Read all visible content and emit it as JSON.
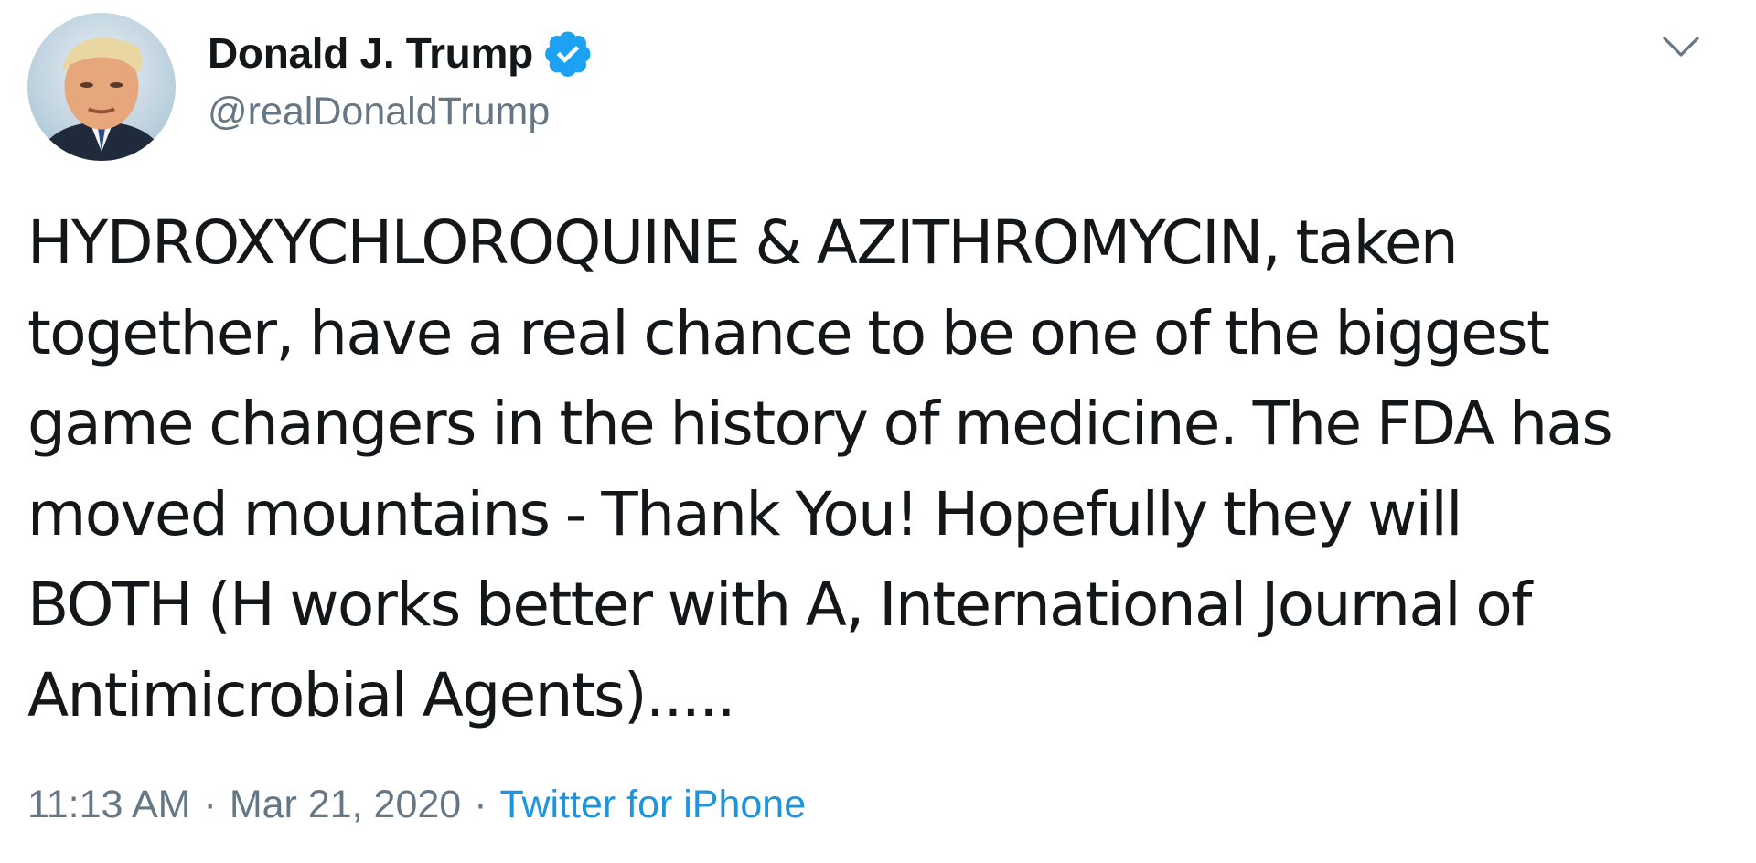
{
  "tweet": {
    "author": {
      "display_name": "Donald J. Trump",
      "handle": "@realDonaldTrump",
      "verified": true,
      "avatar_icon": "profile-photo"
    },
    "menu_icon": "chevron-down-icon",
    "text": "HYDROXYCHLOROQUINE & AZITHROMYCIN, taken\ntogether, have a real chance to be one of the biggest\ngame changers in the history of medicine. The FDA has\nmoved mountains - Thank You! Hopefully they will\nBOTH (H works better with A, International Journal of\nAntimicrobial Agents).....",
    "time": "11:13 AM",
    "separator": "·",
    "date": "Mar 21, 2020",
    "source": "Twitter for iPhone"
  },
  "colors": {
    "text_primary": "#14171a",
    "text_secondary": "#657786",
    "link": "#1b95e0",
    "verified_badge": "#1da1f2",
    "background": "#ffffff"
  }
}
